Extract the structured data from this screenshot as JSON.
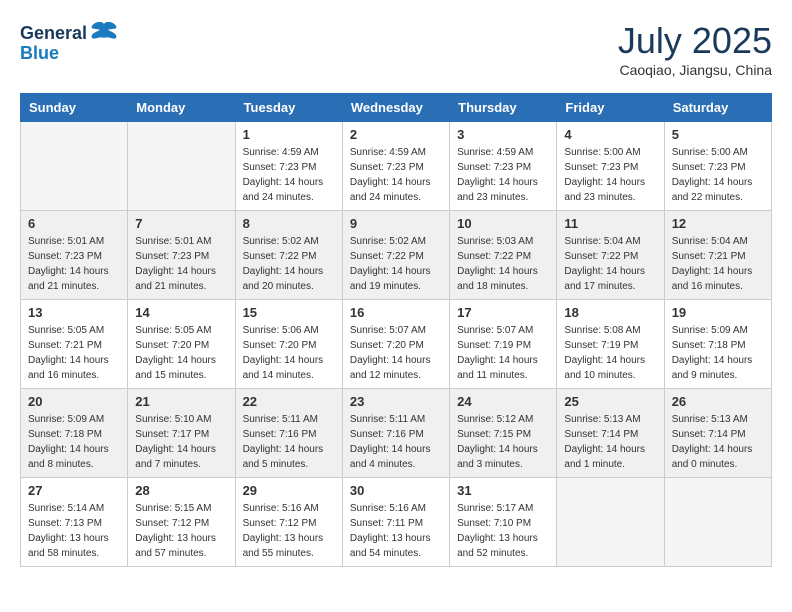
{
  "logo": {
    "text1": "General",
    "text2": "Blue"
  },
  "title": "July 2025",
  "location": "Caoqiao, Jiangsu, China",
  "weekdays": [
    "Sunday",
    "Monday",
    "Tuesday",
    "Wednesday",
    "Thursday",
    "Friday",
    "Saturday"
  ],
  "rows": [
    {
      "cells": [
        {
          "empty": true
        },
        {
          "empty": true
        },
        {
          "day": "1",
          "sunrise": "Sunrise: 4:59 AM",
          "sunset": "Sunset: 7:23 PM",
          "daylight": "Daylight: 14 hours and 24 minutes."
        },
        {
          "day": "2",
          "sunrise": "Sunrise: 4:59 AM",
          "sunset": "Sunset: 7:23 PM",
          "daylight": "Daylight: 14 hours and 24 minutes."
        },
        {
          "day": "3",
          "sunrise": "Sunrise: 4:59 AM",
          "sunset": "Sunset: 7:23 PM",
          "daylight": "Daylight: 14 hours and 23 minutes."
        },
        {
          "day": "4",
          "sunrise": "Sunrise: 5:00 AM",
          "sunset": "Sunset: 7:23 PM",
          "daylight": "Daylight: 14 hours and 23 minutes."
        },
        {
          "day": "5",
          "sunrise": "Sunrise: 5:00 AM",
          "sunset": "Sunset: 7:23 PM",
          "daylight": "Daylight: 14 hours and 22 minutes."
        }
      ]
    },
    {
      "cells": [
        {
          "day": "6",
          "sunrise": "Sunrise: 5:01 AM",
          "sunset": "Sunset: 7:23 PM",
          "daylight": "Daylight: 14 hours and 21 minutes."
        },
        {
          "day": "7",
          "sunrise": "Sunrise: 5:01 AM",
          "sunset": "Sunset: 7:23 PM",
          "daylight": "Daylight: 14 hours and 21 minutes."
        },
        {
          "day": "8",
          "sunrise": "Sunrise: 5:02 AM",
          "sunset": "Sunset: 7:22 PM",
          "daylight": "Daylight: 14 hours and 20 minutes."
        },
        {
          "day": "9",
          "sunrise": "Sunrise: 5:02 AM",
          "sunset": "Sunset: 7:22 PM",
          "daylight": "Daylight: 14 hours and 19 minutes."
        },
        {
          "day": "10",
          "sunrise": "Sunrise: 5:03 AM",
          "sunset": "Sunset: 7:22 PM",
          "daylight": "Daylight: 14 hours and 18 minutes."
        },
        {
          "day": "11",
          "sunrise": "Sunrise: 5:04 AM",
          "sunset": "Sunset: 7:22 PM",
          "daylight": "Daylight: 14 hours and 17 minutes."
        },
        {
          "day": "12",
          "sunrise": "Sunrise: 5:04 AM",
          "sunset": "Sunset: 7:21 PM",
          "daylight": "Daylight: 14 hours and 16 minutes."
        }
      ]
    },
    {
      "cells": [
        {
          "day": "13",
          "sunrise": "Sunrise: 5:05 AM",
          "sunset": "Sunset: 7:21 PM",
          "daylight": "Daylight: 14 hours and 16 minutes."
        },
        {
          "day": "14",
          "sunrise": "Sunrise: 5:05 AM",
          "sunset": "Sunset: 7:20 PM",
          "daylight": "Daylight: 14 hours and 15 minutes."
        },
        {
          "day": "15",
          "sunrise": "Sunrise: 5:06 AM",
          "sunset": "Sunset: 7:20 PM",
          "daylight": "Daylight: 14 hours and 14 minutes."
        },
        {
          "day": "16",
          "sunrise": "Sunrise: 5:07 AM",
          "sunset": "Sunset: 7:20 PM",
          "daylight": "Daylight: 14 hours and 12 minutes."
        },
        {
          "day": "17",
          "sunrise": "Sunrise: 5:07 AM",
          "sunset": "Sunset: 7:19 PM",
          "daylight": "Daylight: 14 hours and 11 minutes."
        },
        {
          "day": "18",
          "sunrise": "Sunrise: 5:08 AM",
          "sunset": "Sunset: 7:19 PM",
          "daylight": "Daylight: 14 hours and 10 minutes."
        },
        {
          "day": "19",
          "sunrise": "Sunrise: 5:09 AM",
          "sunset": "Sunset: 7:18 PM",
          "daylight": "Daylight: 14 hours and 9 minutes."
        }
      ]
    },
    {
      "cells": [
        {
          "day": "20",
          "sunrise": "Sunrise: 5:09 AM",
          "sunset": "Sunset: 7:18 PM",
          "daylight": "Daylight: 14 hours and 8 minutes."
        },
        {
          "day": "21",
          "sunrise": "Sunrise: 5:10 AM",
          "sunset": "Sunset: 7:17 PM",
          "daylight": "Daylight: 14 hours and 7 minutes."
        },
        {
          "day": "22",
          "sunrise": "Sunrise: 5:11 AM",
          "sunset": "Sunset: 7:16 PM",
          "daylight": "Daylight: 14 hours and 5 minutes."
        },
        {
          "day": "23",
          "sunrise": "Sunrise: 5:11 AM",
          "sunset": "Sunset: 7:16 PM",
          "daylight": "Daylight: 14 hours and 4 minutes."
        },
        {
          "day": "24",
          "sunrise": "Sunrise: 5:12 AM",
          "sunset": "Sunset: 7:15 PM",
          "daylight": "Daylight: 14 hours and 3 minutes."
        },
        {
          "day": "25",
          "sunrise": "Sunrise: 5:13 AM",
          "sunset": "Sunset: 7:14 PM",
          "daylight": "Daylight: 14 hours and 1 minute."
        },
        {
          "day": "26",
          "sunrise": "Sunrise: 5:13 AM",
          "sunset": "Sunset: 7:14 PM",
          "daylight": "Daylight: 14 hours and 0 minutes."
        }
      ]
    },
    {
      "cells": [
        {
          "day": "27",
          "sunrise": "Sunrise: 5:14 AM",
          "sunset": "Sunset: 7:13 PM",
          "daylight": "Daylight: 13 hours and 58 minutes."
        },
        {
          "day": "28",
          "sunrise": "Sunrise: 5:15 AM",
          "sunset": "Sunset: 7:12 PM",
          "daylight": "Daylight: 13 hours and 57 minutes."
        },
        {
          "day": "29",
          "sunrise": "Sunrise: 5:16 AM",
          "sunset": "Sunset: 7:12 PM",
          "daylight": "Daylight: 13 hours and 55 minutes."
        },
        {
          "day": "30",
          "sunrise": "Sunrise: 5:16 AM",
          "sunset": "Sunset: 7:11 PM",
          "daylight": "Daylight: 13 hours and 54 minutes."
        },
        {
          "day": "31",
          "sunrise": "Sunrise: 5:17 AM",
          "sunset": "Sunset: 7:10 PM",
          "daylight": "Daylight: 13 hours and 52 minutes."
        },
        {
          "empty": true
        },
        {
          "empty": true
        }
      ]
    }
  ]
}
